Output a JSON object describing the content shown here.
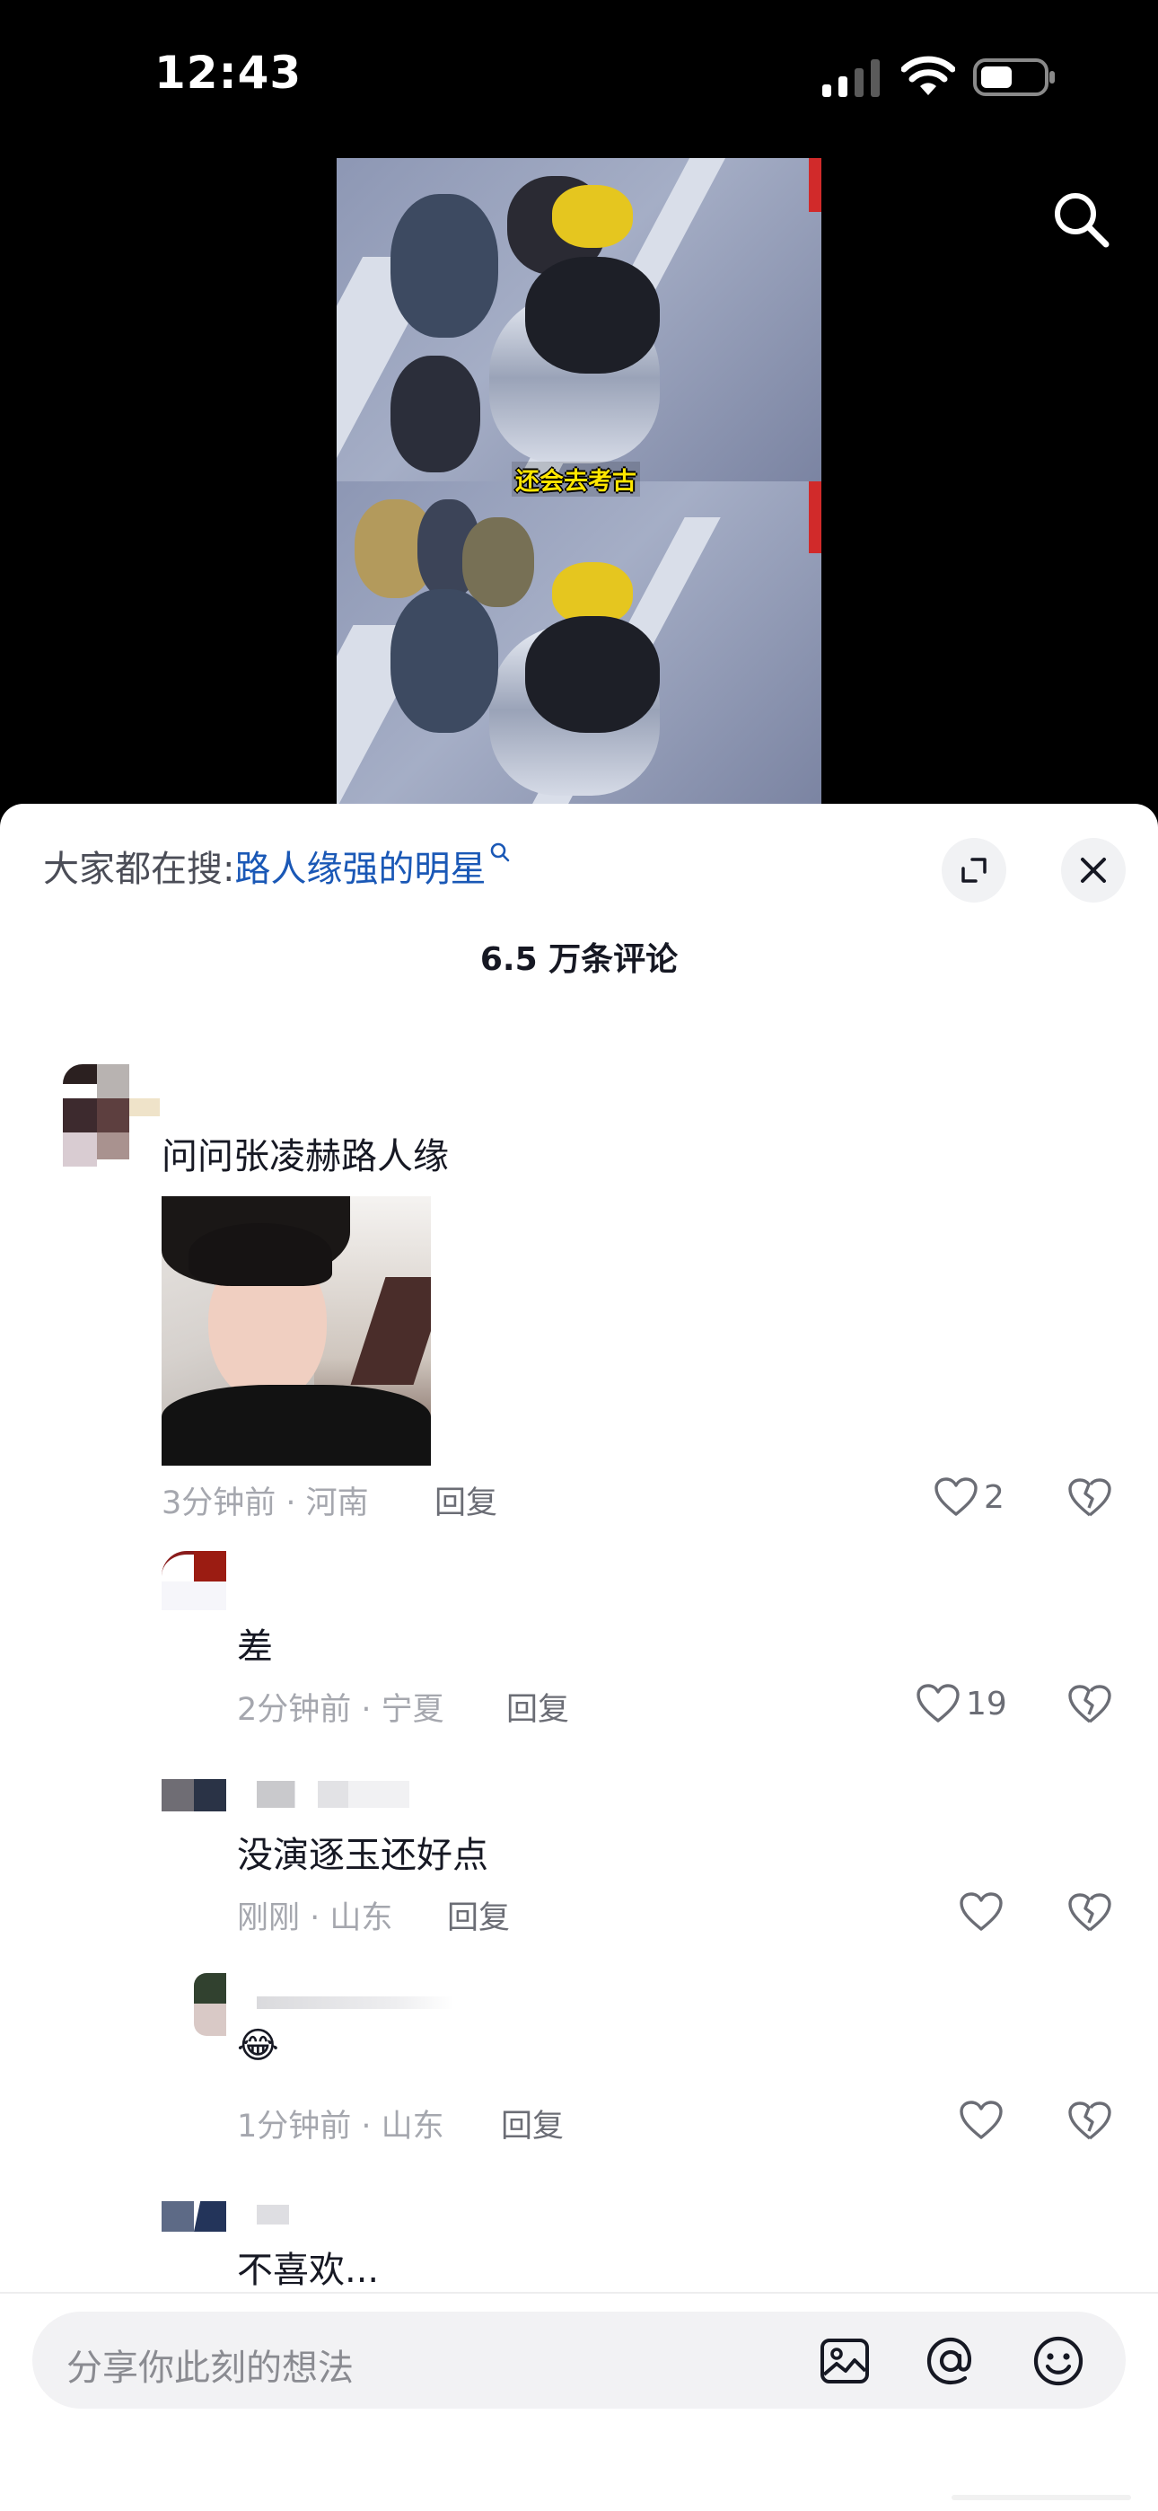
{
  "status_bar": {
    "time": "12:43"
  },
  "video": {
    "caption": "还会去考古"
  },
  "sheet": {
    "search_prefix": "大家都在搜:",
    "search_keyword": "路人缘强的明星",
    "comment_count": "6.5 万条评论"
  },
  "comments": [
    {
      "text": "问问张凌赫路人缘",
      "meta": "3分钟前 · 河南",
      "reply": "回复",
      "likes": "2"
    },
    {
      "text": "差",
      "meta": "2分钟前 · 宁夏",
      "reply": "回复",
      "likes": "19"
    },
    {
      "text": "没演逐玉还好点",
      "meta": "刚刚 · 山东",
      "reply": "回复",
      "likes": ""
    },
    {
      "text": "😂",
      "meta": "1分钟前 · 山东",
      "reply": "回复",
      "likes": ""
    },
    {
      "text": "不喜欢..."
    }
  ],
  "input": {
    "placeholder": "分享你此刻的想法"
  },
  "colors": {
    "link": "#1a58b6",
    "meta": "#a5a7ae",
    "caption": "#ffe600"
  }
}
